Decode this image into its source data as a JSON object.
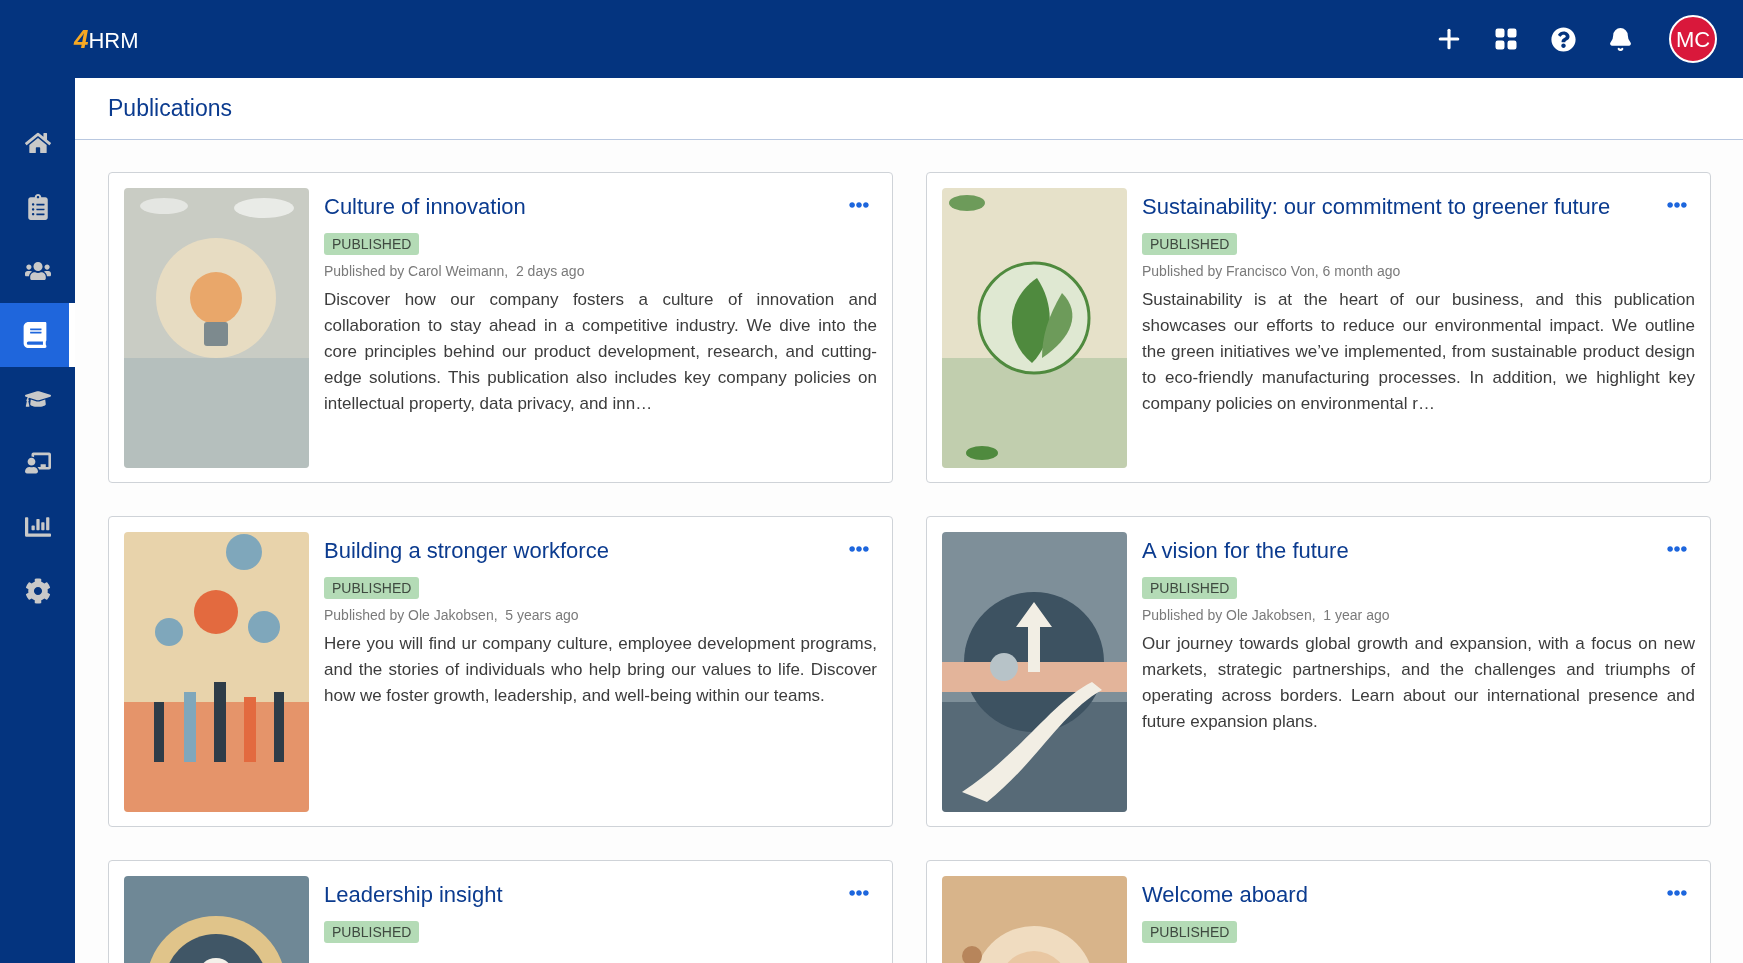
{
  "logo": {
    "mark": "4",
    "text": "HRM"
  },
  "top_actions": [
    {
      "kind": "add"
    },
    {
      "kind": "apps"
    },
    {
      "kind": "help"
    },
    {
      "kind": "notifications"
    }
  ],
  "user": {
    "initials": "MC"
  },
  "sidebar": {
    "items": [
      {
        "kind": "home",
        "selected": false
      },
      {
        "kind": "tasks",
        "selected": false
      },
      {
        "kind": "people",
        "selected": false
      },
      {
        "kind": "publications",
        "selected": true
      },
      {
        "kind": "learning",
        "selected": false
      },
      {
        "kind": "training",
        "selected": false
      },
      {
        "kind": "reports",
        "selected": false
      },
      {
        "kind": "settings",
        "selected": false
      }
    ]
  },
  "page": {
    "title": "Publications"
  },
  "publications": [
    {
      "title": "Culture of innovation",
      "status": "PUBLISHED",
      "byline": "Published by Carol Weimann,  2 days ago",
      "description": "Discover how our company fosters a culture of innovation and collaboration to stay ahead in a competitive industry. We dive into the core principles behind our product development, research, and cutting-edge solutions. This publication also includes key company policies on intellectual property, data privacy, and inn…"
    },
    {
      "title": "Sustainability: our commitment to greener future",
      "status": "PUBLISHED",
      "byline": "Published by Francisco Von, 6 month ago",
      "description": "Sustainability is at the heart of our business, and this publication showcases our efforts to reduce our environmental impact. We outline the green initiatives we’ve implemented, from sustainable product design to eco-friendly manufacturing processes. In addition, we highlight key company policies on environmental r…"
    },
    {
      "title": "Building a stronger workforce",
      "status": "PUBLISHED",
      "byline": "Published by Ole Jakobsen,  5 years ago",
      "description": "Here you will find ur company culture, employee development programs, and the stories of individuals who help bring our values to life. Discover how we foster growth, leadership, and well-being within our teams."
    },
    {
      "title": "A vision for the future",
      "status": "PUBLISHED",
      "byline": "Published by Ole Jakobsen,  1 year ago",
      "description": "Our journey towards global growth and expansion, with a focus on new markets, strategic partnerships, and the challenges and triumphs of operating across borders. Learn about our international presence and future expansion plans."
    },
    {
      "title": "Leadership insight",
      "status": "PUBLISHED"
    },
    {
      "title": "Welcome aboard",
      "status": "PUBLISHED"
    }
  ]
}
